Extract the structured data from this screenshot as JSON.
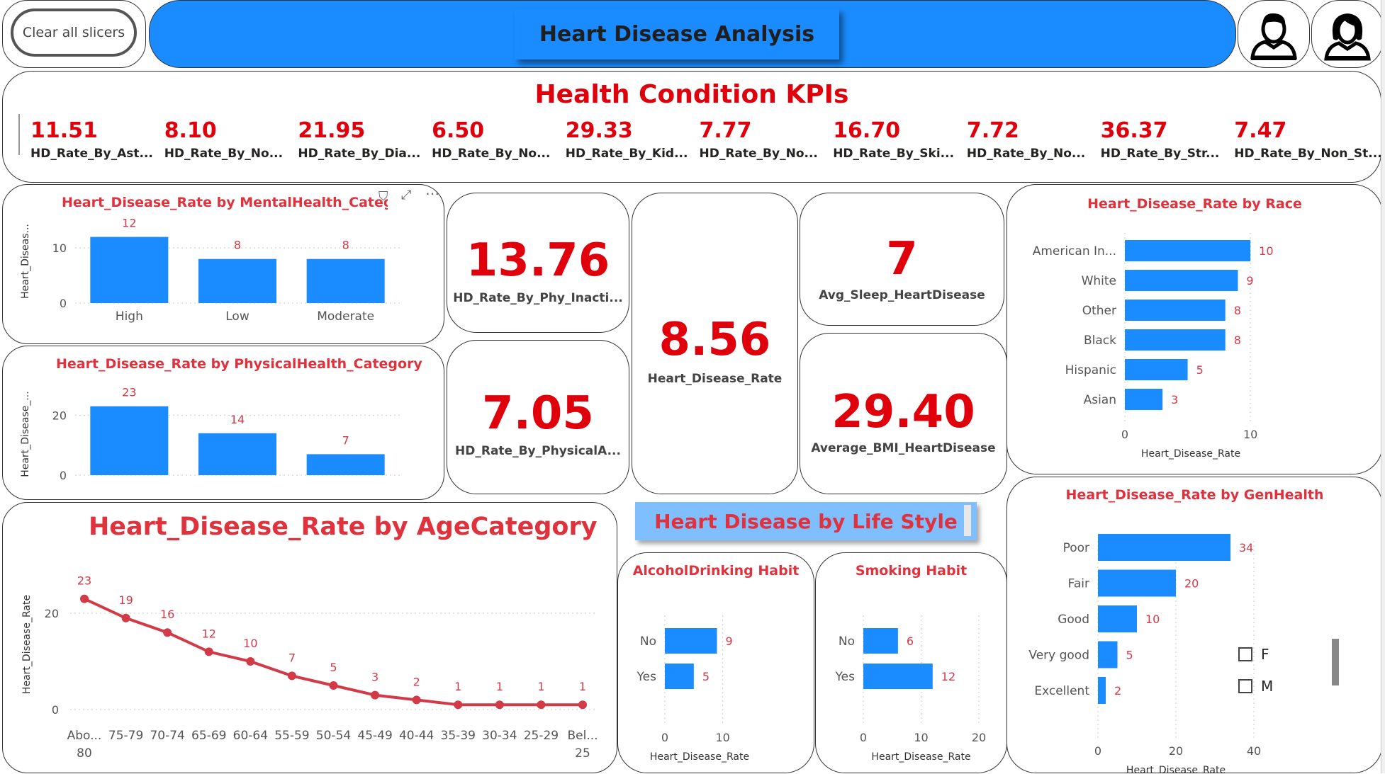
{
  "header": {
    "clear_slicers": "Clear all slicers",
    "title": "Heart Disease Analysis"
  },
  "kpi_strip": {
    "title": "Health Condition KPIs",
    "items": [
      {
        "value": "11.51",
        "label": "HD_Rate_By_Ast..."
      },
      {
        "value": "8.10",
        "label": "HD_Rate_By_No..."
      },
      {
        "value": "21.95",
        "label": "HD_Rate_By_Dia..."
      },
      {
        "value": "6.50",
        "label": "HD_Rate_By_No..."
      },
      {
        "value": "29.33",
        "label": "HD_Rate_By_Kid..."
      },
      {
        "value": "7.77",
        "label": "HD_Rate_By_No..."
      },
      {
        "value": "16.70",
        "label": "HD_Rate_By_Ski..."
      },
      {
        "value": "7.72",
        "label": "HD_Rate_By_No..."
      },
      {
        "value": "36.37",
        "label": "HD_Rate_By_Str..."
      },
      {
        "value": "7.47",
        "label": "HD_Rate_By_Non_St..."
      }
    ]
  },
  "cards": {
    "phy_inactive": {
      "value": "13.76",
      "label": "HD_Rate_By_Phy_Inacti..."
    },
    "phy_active": {
      "value": "7.05",
      "label": "HD_Rate_By_PhysicalA..."
    },
    "hd_rate": {
      "value": "8.56",
      "label": "Heart_Disease_Rate"
    },
    "sleep": {
      "value": "7",
      "label": "Avg_Sleep_HeartDisease"
    },
    "bmi": {
      "value": "29.40",
      "label": "Average_BMI_HeartDisease"
    }
  },
  "lifestyle_banner": "Heart Disease by Life Style",
  "gender_slicer": {
    "options": [
      "F",
      "M"
    ]
  },
  "chart_data": [
    {
      "id": "mental",
      "type": "bar",
      "title": "Heart_Disease_Rate by MentalHealth_Category",
      "ylabel": "Heart_Diseas...",
      "categories": [
        "High",
        "Low",
        "Moderate"
      ],
      "values": [
        12,
        8,
        8
      ],
      "ylim": [
        0,
        14
      ],
      "yticks": [
        0,
        10
      ]
    },
    {
      "id": "physical",
      "type": "bar",
      "title": "Heart_Disease_Rate by PhysicalHealth_Category",
      "ylabel": "Heart_Disease_...",
      "categories": [
        "",
        "",
        ""
      ],
      "values": [
        23,
        14,
        7
      ],
      "ylim": [
        0,
        26
      ],
      "yticks": [
        0,
        20
      ]
    },
    {
      "id": "age",
      "type": "line",
      "title": "Heart_Disease_Rate by AgeCategory",
      "ylabel": "Heart_Disease_Rate",
      "categories": [
        "Abo... 80",
        "75-79",
        "70-74",
        "65-69",
        "60-64",
        "55-59",
        "50-54",
        "45-49",
        "40-44",
        "35-39",
        "30-34",
        "25-29",
        "Bel... 25"
      ],
      "values": [
        23,
        19,
        16,
        12,
        10,
        7,
        5,
        3,
        2,
        1,
        1,
        1,
        1
      ],
      "ylim": [
        0,
        25
      ],
      "yticks": [
        0,
        20
      ]
    },
    {
      "id": "race",
      "type": "bar",
      "orientation": "horizontal",
      "title": "Heart_Disease_Rate by Race",
      "xlabel": "Heart_Disease_Rate",
      "categories": [
        "American In...",
        "White",
        "Other",
        "Black",
        "Hispanic",
        "Asian"
      ],
      "values": [
        10,
        9,
        8,
        8,
        5,
        3
      ],
      "xlim": [
        0,
        10.5
      ],
      "xticks": [
        0,
        10
      ]
    },
    {
      "id": "genhealth",
      "type": "bar",
      "orientation": "horizontal",
      "title": "Heart_Disease_Rate by GenHealth",
      "xlabel": "Heart_Disease_Rate",
      "categories": [
        "Poor",
        "Fair",
        "Good",
        "Very good",
        "Excellent"
      ],
      "values": [
        34,
        20,
        10,
        5,
        2
      ],
      "xlim": [
        0,
        40
      ],
      "xticks": [
        0,
        20,
        40
      ]
    },
    {
      "id": "alcohol",
      "type": "bar",
      "orientation": "horizontal",
      "title": "AlcoholDrinking Habit",
      "xlabel": "Heart_Disease_Rate",
      "categories": [
        "No",
        "Yes"
      ],
      "values": [
        9,
        5
      ],
      "xlim": [
        0,
        12
      ],
      "xticks": [
        0,
        10
      ]
    },
    {
      "id": "smoking",
      "type": "bar",
      "orientation": "horizontal",
      "title": "Smoking Habit",
      "xlabel": "Heart_Disease_Rate",
      "categories": [
        "No",
        "Yes"
      ],
      "values": [
        6,
        12
      ],
      "xlim": [
        0,
        20
      ],
      "xticks": [
        0,
        10,
        20
      ]
    }
  ],
  "colors": {
    "bar": "#1a8cff",
    "line": "#d23a48",
    "title": "#e0323d",
    "kpi": "#e0000c",
    "header": "#1a8cff"
  }
}
